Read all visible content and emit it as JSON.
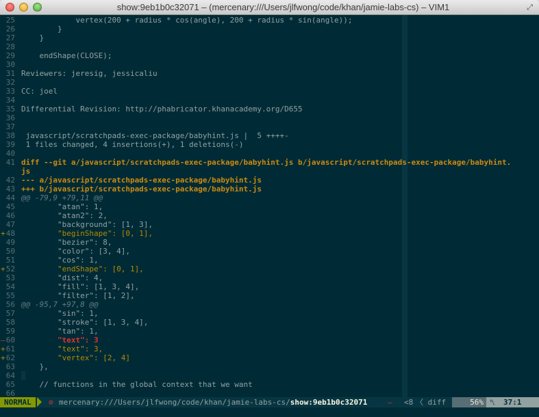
{
  "window": {
    "title": "show:9eb1b0c32071 – (mercenary:///Users/jlfwong/code/khan/jamie-labs-cs) – VIM1",
    "fullscreen_glyph": "⤢"
  },
  "lines": [
    {
      "n": "25",
      "sign": "",
      "kind": "plain",
      "text": "            vertex(200 + radius * cos(angle), 200 + radius * sin(angle));"
    },
    {
      "n": "26",
      "sign": "",
      "kind": "plain",
      "text": "        }"
    },
    {
      "n": "27",
      "sign": "",
      "kind": "plain",
      "text": "    }"
    },
    {
      "n": "28",
      "sign": "",
      "kind": "plain",
      "text": ""
    },
    {
      "n": "29",
      "sign": "",
      "kind": "plain",
      "text": "    endShape(CLOSE);"
    },
    {
      "n": "30",
      "sign": "",
      "kind": "plain",
      "text": ""
    },
    {
      "n": "31",
      "sign": "",
      "kind": "plain",
      "text": "Reviewers: jeresig, jessicaliu"
    },
    {
      "n": "32",
      "sign": "",
      "kind": "plain",
      "text": ""
    },
    {
      "n": "33",
      "sign": "",
      "kind": "plain",
      "text": "CC: joel"
    },
    {
      "n": "34",
      "sign": "",
      "kind": "plain",
      "text": ""
    },
    {
      "n": "35",
      "sign": "",
      "kind": "plain",
      "text": "Differential Revision: http://phabricator.khanacademy.org/D655"
    },
    {
      "n": "36",
      "sign": "",
      "kind": "plain",
      "text": ""
    },
    {
      "n": "37",
      "sign": "",
      "kind": "plain",
      "text": ""
    },
    {
      "n": "38",
      "sign": "",
      "kind": "plain",
      "text": " javascript/scratchpads-exec-package/babyhint.js |  5 ++++-"
    },
    {
      "n": "39",
      "sign": "",
      "kind": "plain",
      "text": " 1 files changed, 4 insertions(+), 1 deletions(-)"
    },
    {
      "n": "40",
      "sign": "",
      "kind": "plain",
      "text": ""
    },
    {
      "n": "41",
      "sign": "",
      "kind": "hdr",
      "text": "diff --git a/javascript/scratchpads-exec-package/babyhint.js b/javascript/scratchpads-exec-package/babyhint.",
      "wrap": "js"
    },
    {
      "n": "42",
      "sign": "",
      "kind": "hdr",
      "text": "--- a/javascript/scratchpads-exec-package/babyhint.js"
    },
    {
      "n": "43",
      "sign": "",
      "kind": "hdr",
      "text": "+++ b/javascript/scratchpads-exec-package/babyhint.js"
    },
    {
      "n": "44",
      "sign": "",
      "kind": "hunk",
      "text": "@@ -79,9 +79,11 @@"
    },
    {
      "n": "45",
      "sign": "",
      "kind": "plain",
      "text": "        \"atan\": 1,"
    },
    {
      "n": "46",
      "sign": "",
      "kind": "plain",
      "text": "        \"atan2\": 2,"
    },
    {
      "n": "47",
      "sign": "",
      "kind": "plain",
      "text": "        \"background\": [1, 3],"
    },
    {
      "n": "48",
      "sign": "+",
      "kind": "add",
      "text": "        \"beginShape\": [0, 1],"
    },
    {
      "n": "49",
      "sign": "",
      "kind": "plain",
      "text": "        \"bezier\": 8,"
    },
    {
      "n": "50",
      "sign": "",
      "kind": "plain",
      "text": "        \"color\": [3, 4],"
    },
    {
      "n": "51",
      "sign": "",
      "kind": "plain",
      "text": "        \"cos\": 1,"
    },
    {
      "n": "52",
      "sign": "+",
      "kind": "add",
      "text": "        \"endShape\": [0, 1],"
    },
    {
      "n": "53",
      "sign": "",
      "kind": "plain",
      "text": "        \"dist\": 4,"
    },
    {
      "n": "54",
      "sign": "",
      "kind": "plain",
      "text": "        \"fill\": [1, 3, 4],"
    },
    {
      "n": "55",
      "sign": "",
      "kind": "plain",
      "text": "        \"filter\": [1, 2],"
    },
    {
      "n": "56",
      "sign": "",
      "kind": "hunk",
      "text": "@@ -95,7 +97,8 @@"
    },
    {
      "n": "57",
      "sign": "",
      "kind": "plain",
      "text": "        \"sin\": 1,"
    },
    {
      "n": "58",
      "sign": "",
      "kind": "plain",
      "text": "        \"stroke\": [1, 3, 4],"
    },
    {
      "n": "59",
      "sign": "",
      "kind": "plain",
      "text": "        \"tan\": 1,"
    },
    {
      "n": "60",
      "sign": "–",
      "kind": "del",
      "text": "        \"text\": 3"
    },
    {
      "n": "61",
      "sign": "+",
      "kind": "add",
      "text": "        \"text\": 3,"
    },
    {
      "n": "62",
      "sign": "+",
      "kind": "add",
      "text": "        \"vertex\": [2, 4]"
    },
    {
      "n": "63",
      "sign": "",
      "kind": "plain",
      "text": "    },"
    },
    {
      "n": "64",
      "sign": "",
      "kind": "bullet",
      "text": ""
    },
    {
      "n": "65",
      "sign": "",
      "kind": "plain",
      "text": "    // functions in the global context that we want"
    },
    {
      "n": "66",
      "sign": "",
      "kind": "plain",
      "text": ""
    }
  ],
  "statusbar": {
    "mode": "NORMAL",
    "lock": "⊘",
    "path_prefix": "mercenary:///Users/jlfwong/code/khan/jamie-labs-cs/",
    "branch": "show:9eb1b0c32071",
    "modified": "–",
    "encoding": "<8",
    "filetype": "〈 diff",
    "percent": "56%",
    "pos_icon": "␤",
    "position": "37:1"
  },
  "colors": {
    "background": "#002b36",
    "line_number": "#586e75",
    "text": "#93a1a1",
    "added": "#b58900",
    "deleted": "#dc322f",
    "diff_header": "#cb8a10",
    "mode_bg": "#859900"
  }
}
